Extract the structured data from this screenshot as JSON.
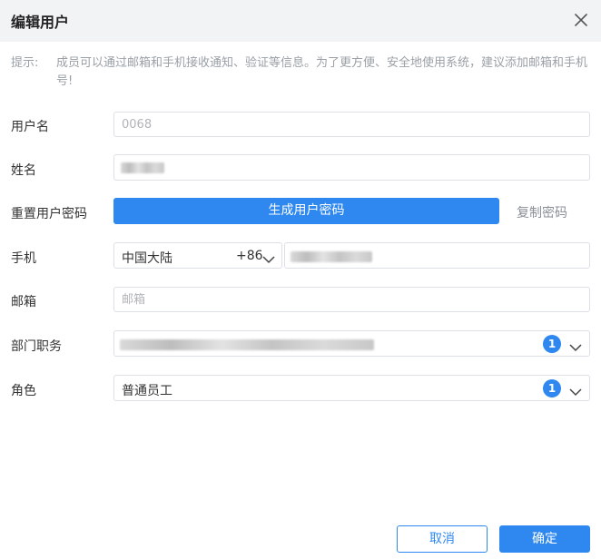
{
  "dialog": {
    "title": "编辑用户",
    "close_icon": "close-icon"
  },
  "tip": {
    "label": "提示:",
    "text": "成员可以通过邮箱和手机接收通知、验证等信息。为了更方便、安全地使用系统，建议添加邮箱和手机号!"
  },
  "form": {
    "username": {
      "label": "用户名",
      "value": "",
      "placeholder": "0068"
    },
    "name": {
      "label": "姓名"
    },
    "reset_password": {
      "label": "重置用户密码",
      "generate_button": "生成用户密码",
      "copy_link": "复制密码"
    },
    "phone": {
      "label": "手机",
      "country": "中国大陆",
      "code": "+86"
    },
    "email": {
      "label": "邮箱",
      "placeholder": "邮箱"
    },
    "department": {
      "label": "部门职务",
      "count": "1"
    },
    "role": {
      "label": "角色",
      "value": "普通员工",
      "count": "1"
    }
  },
  "footer": {
    "cancel": "取消",
    "ok": "确定"
  },
  "colors": {
    "primary": "#2f88f0",
    "header_bg": "#f2f3f5"
  }
}
